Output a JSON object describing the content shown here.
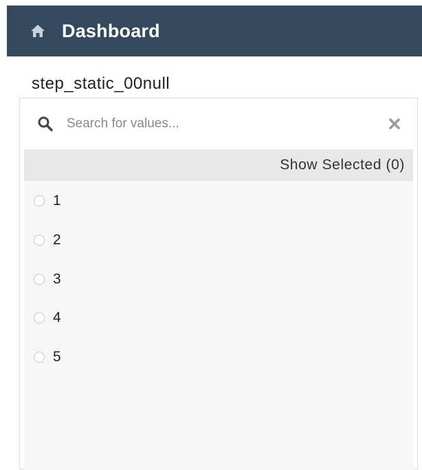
{
  "header": {
    "title": "Dashboard",
    "icon": "home-icon",
    "background": "#34495e"
  },
  "filter": {
    "label": "step_static_00null",
    "search": {
      "placeholder": "Search for values...",
      "value": ""
    },
    "show_selected_label": "Show Selected (0)",
    "values": [
      {
        "label": "1",
        "selected": false
      },
      {
        "label": "2",
        "selected": false
      },
      {
        "label": "3",
        "selected": false
      },
      {
        "label": "4",
        "selected": false
      },
      {
        "label": "5",
        "selected": false
      }
    ]
  }
}
